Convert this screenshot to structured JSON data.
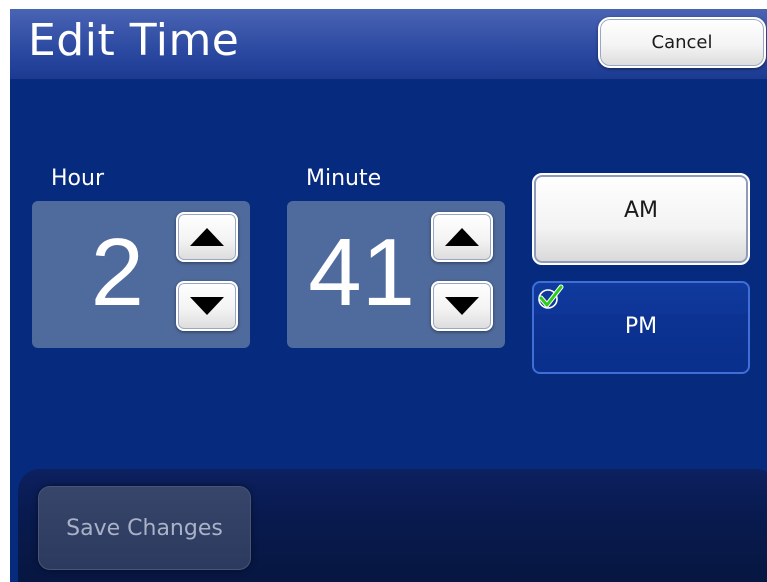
{
  "header": {
    "title": "Edit Time",
    "cancel_label": "Cancel"
  },
  "hour": {
    "label": "Hour",
    "value": "2",
    "up_icon": "triangle-up-icon",
    "down_icon": "triangle-down-icon"
  },
  "minute": {
    "label": "Minute",
    "value": "41",
    "up_icon": "triangle-up-icon",
    "down_icon": "triangle-down-icon"
  },
  "period": {
    "options": [
      {
        "label": "AM",
        "selected": false
      },
      {
        "label": "PM",
        "selected": true
      }
    ],
    "selected_icon": "checkmark-icon"
  },
  "footer": {
    "save_label": "Save Changes",
    "save_enabled": false
  },
  "colors": {
    "background": "#062a7e",
    "header_top": "#4a64b4",
    "panel": "#4f6a9c",
    "selected_border": "#3f6fd6",
    "check_green": "#2ecc1a"
  }
}
